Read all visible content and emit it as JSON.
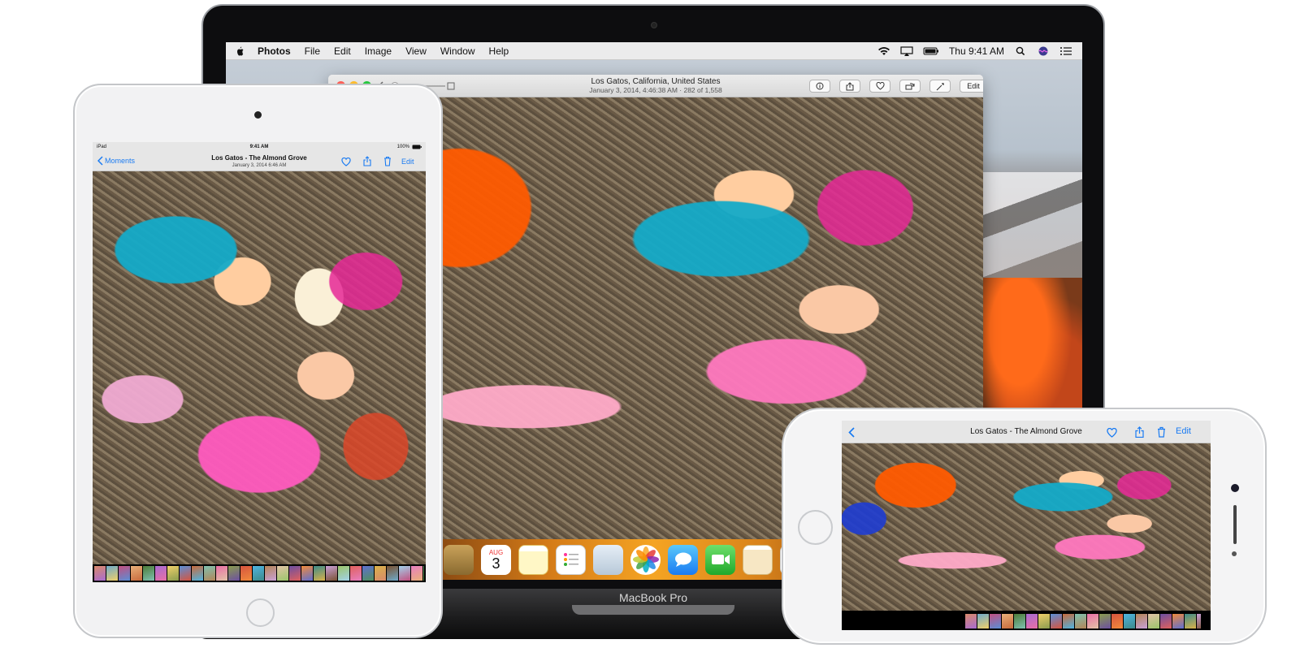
{
  "macbook": {
    "menubar": {
      "app_name": "Photos",
      "menus": [
        "File",
        "Edit",
        "Image",
        "View",
        "Window",
        "Help"
      ],
      "clock": "Thu 9:41 AM"
    },
    "window": {
      "title": "Los Gatos, California, United States",
      "subtitle": "January 3, 2014, 4:46:38 AM  ·  282 of 1,558",
      "edit_label": "Edit"
    },
    "dock": {
      "calendar_month": "AUG",
      "calendar_day": "3",
      "icons": [
        "photo-browser-icon",
        "calendar-icon",
        "notes-icon",
        "reminders-icon",
        "preview-icon",
        "photos-icon",
        "messages-icon",
        "facetime-icon",
        "pages-icon",
        "numbers-icon"
      ]
    },
    "label": "MacBook Pro"
  },
  "ipad": {
    "status": {
      "carrier": "iPad",
      "time": "9:41 AM",
      "battery": "100%"
    },
    "nav": {
      "back_label": "Moments",
      "title": "Los Gatos - The Almond Grove",
      "subtitle": "January 3, 2014  6:46 AM",
      "edit_label": "Edit"
    }
  },
  "iphone": {
    "nav": {
      "title": "Los Gatos - The Almond Grove",
      "edit_label": "Edit"
    }
  },
  "colors": {
    "ios_accent": "#1a7bf2",
    "window_chrome": "#ececec",
    "traffic_red": "#fc5f57",
    "traffic_yellow": "#fdbc2e",
    "traffic_green": "#28c840"
  },
  "filmstrip_colors": [
    "#d98a6b",
    "#6fa9c9",
    "#c24f7f",
    "#e8b07a",
    "#4d7c3a",
    "#a86bd0",
    "#f0d06a",
    "#5a8fd6",
    "#c76a3c",
    "#7ec1b0",
    "#e96fa5",
    "#8a9c4e",
    "#d6543e",
    "#4fb4e0",
    "#b38558",
    "#e2c3a7",
    "#6c4fa0",
    "#f08a3c",
    "#3d8a8a",
    "#c9a0d6",
    "#9bc46a",
    "#e0605d",
    "#5f6fd0",
    "#d9b24a",
    "#7a5232",
    "#a2d2ea",
    "#e77fbf",
    "#51905c"
  ]
}
